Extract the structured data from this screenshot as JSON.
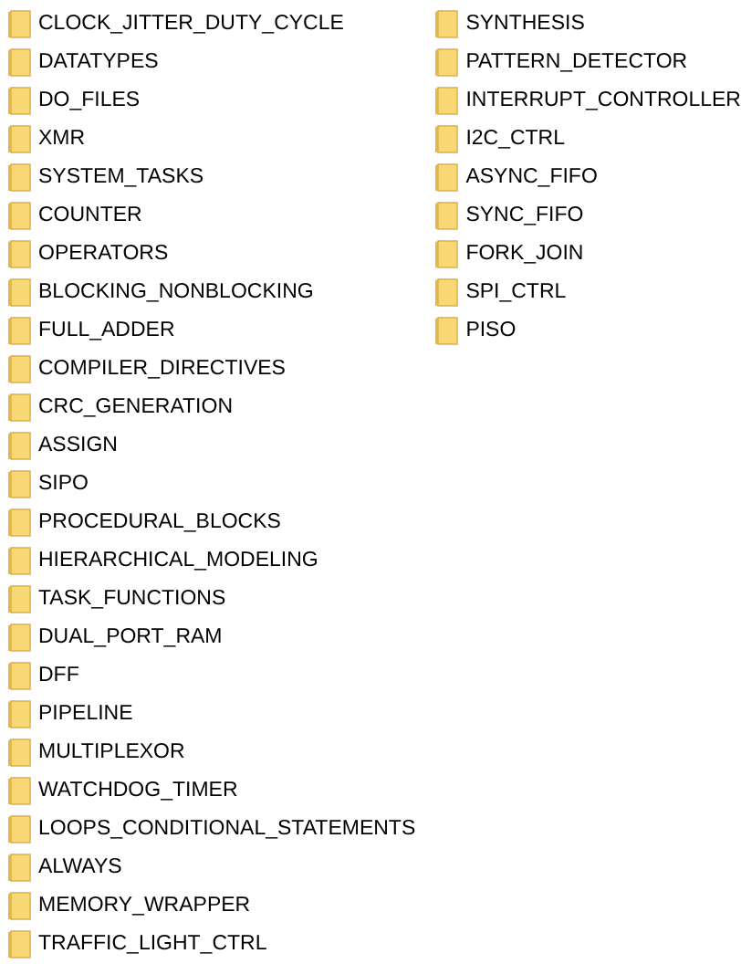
{
  "columns": [
    {
      "folders": [
        "CLOCK_JITTER_DUTY_CYCLE",
        "DATATYPES",
        "DO_FILES",
        "XMR",
        "SYSTEM_TASKS",
        "COUNTER",
        "OPERATORS",
        "BLOCKING_NONBLOCKING",
        "FULL_ADDER",
        "COMPILER_DIRECTIVES",
        "CRC_GENERATION",
        "ASSIGN",
        "SIPO",
        "PROCEDURAL_BLOCKS",
        "HIERARCHICAL_MODELING",
        "TASK_FUNCTIONS",
        "DUAL_PORT_RAM",
        "DFF",
        "PIPELINE",
        "MULTIPLEXOR",
        "WATCHDOG_TIMER",
        "LOOPS_CONDITIONAL_STATEMENTS",
        "ALWAYS",
        "MEMORY_WRAPPER",
        "TRAFFIC_LIGHT_CTRL"
      ]
    },
    {
      "folders": [
        "SYNTHESIS",
        "PATTERN_DETECTOR",
        "INTERRUPT_CONTROLLER",
        "I2C_CTRL",
        "ASYNC_FIFO",
        "SYNC_FIFO",
        "FORK_JOIN",
        "SPI_CTRL",
        "PISO"
      ]
    }
  ]
}
